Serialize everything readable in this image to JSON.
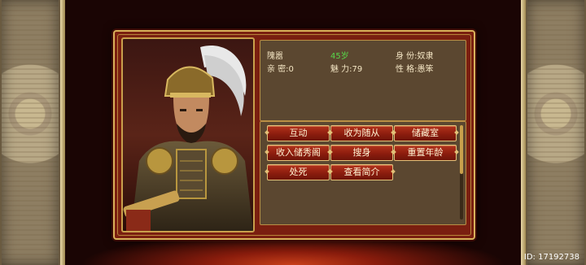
{
  "character": {
    "name": "隗嚣",
    "age": "45岁",
    "status": "身 份:奴隶",
    "intimacy": "亲 密:0",
    "charm": "魅 力:79",
    "personality": "性 格:愚笨"
  },
  "actions": [
    {
      "label": "互动"
    },
    {
      "label": "收为随从"
    },
    {
      "label": "储藏室"
    },
    {
      "label": "收入储秀阁"
    },
    {
      "label": "搜身"
    },
    {
      "label": "重置年龄"
    },
    {
      "label": "处死"
    },
    {
      "label": "查看简介"
    }
  ],
  "footer": {
    "player_id": "ID: 17192738"
  },
  "colors": {
    "panel": "#7a1f10",
    "gold_border": "#d9b15a",
    "info_bg": "#5b4730",
    "age_green": "#57d64a",
    "button_red": "#8c1d0e"
  }
}
